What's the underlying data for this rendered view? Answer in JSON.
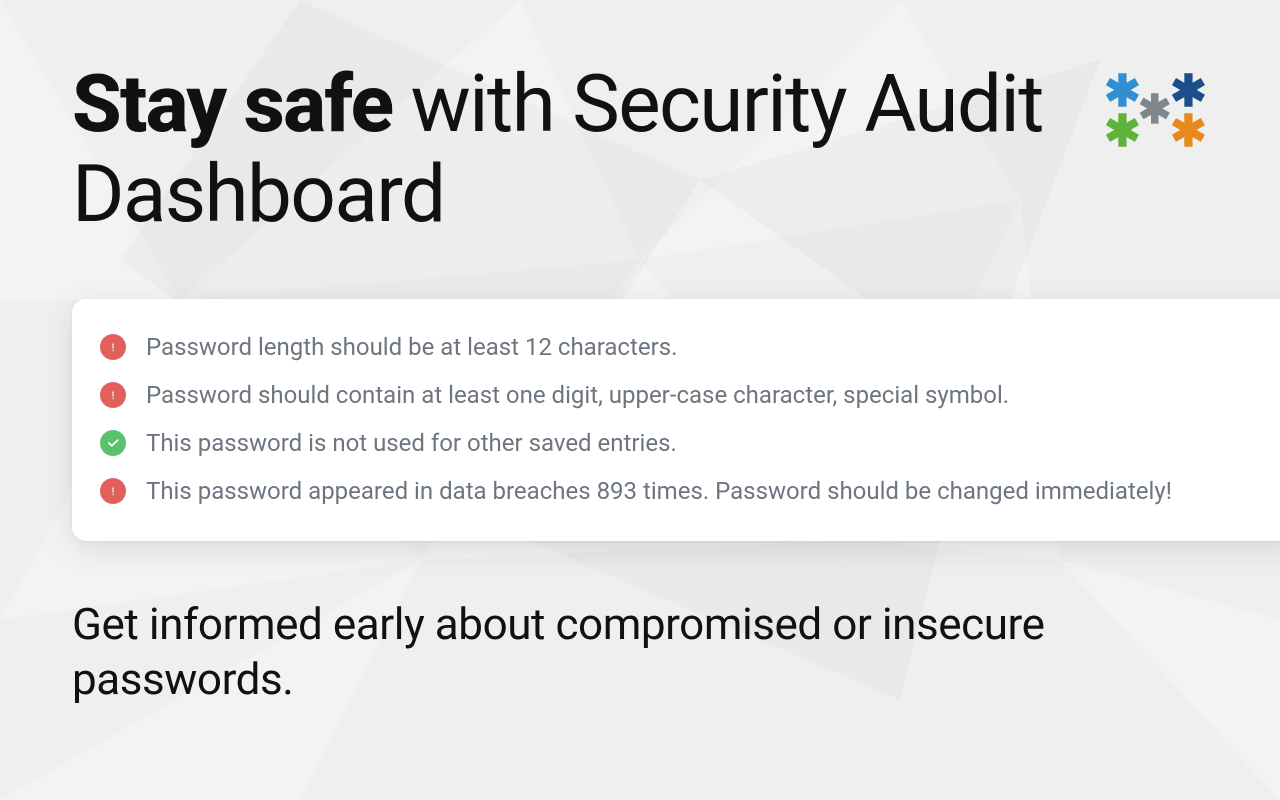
{
  "headline": {
    "bold": "Stay safe",
    "rest": " with Security Audit Dashboard"
  },
  "logo": {
    "asterisks": [
      {
        "name": "blue"
      },
      {
        "name": "navy"
      },
      {
        "name": "gray"
      },
      {
        "name": "green"
      },
      {
        "name": "orange"
      }
    ]
  },
  "rules": [
    {
      "status": "error",
      "text": "Password length should be at least 12 characters."
    },
    {
      "status": "error",
      "text": "Password should contain at least one digit, upper-case character, special symbol."
    },
    {
      "status": "ok",
      "text": "This password is not used for other saved entries."
    },
    {
      "status": "error",
      "text": "This password appeared in data breaches 893 times. Password should be changed immediately! "
    }
  ],
  "subhead": "Get informed early about compromised or insecure passwords."
}
